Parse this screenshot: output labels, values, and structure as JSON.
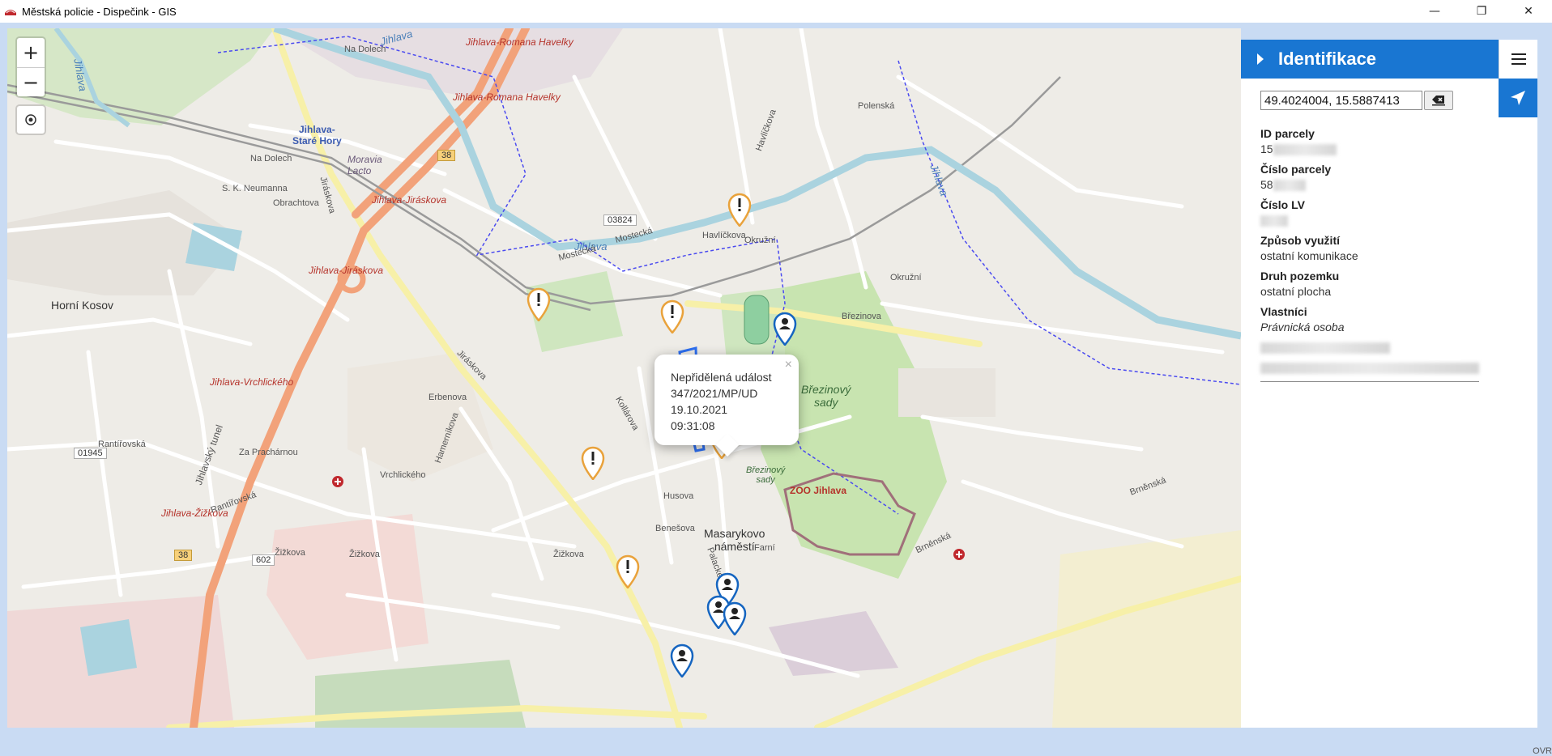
{
  "window": {
    "title": "Městská policie - Dispečink - GIS",
    "controls": {
      "minimize": "—",
      "restore": "❐",
      "close": "✕"
    }
  },
  "map": {
    "zoom_in": "+",
    "zoom_out": "−",
    "labels": {
      "romana_havelky_1": "Jihlava-Romana Havelky",
      "romana_havelky_2": "Jihlava-Romana Havelky",
      "stare_hory": "Jihlava-\nStaré Hory",
      "moravia_lacto": "Moravia\nLacto",
      "jiraskova_1": "Jihlava-Jiráskova",
      "jiraskova_2": "Jihlava-Jiráskova",
      "vrchlickeho": "Jihlava-Vrchlického",
      "zizkova": "Jihlava-Žižkova",
      "horni_kosov": "Horní Kosov",
      "brezinovy_sady": "Březinový\nsady",
      "brezinovy_sady_2": "Březinový\nsady",
      "zoo": "ZOO Jihlava",
      "masarykovo": "Masarykovo\nnáměstí",
      "jihlava_river_1": "Jihlava",
      "jihlava_river_2": "Jihlava",
      "jihlava_river_3": "Jihlava",
      "jihlava_river_4": "Jihlava",
      "street_neumanna": "S. K. Neumanna",
      "street_jiraskova": "Jiráskova",
      "street_jiraskova_2": "Jiráskova",
      "street_vrchlickeho": "Vrchlického",
      "street_zizkova_1": "Žižkova",
      "street_zizkova_2": "Žižkova",
      "street_zizkova_3": "Žižkova",
      "street_okruzni": "Okružní",
      "street_okruzni_2": "Okružní",
      "street_havlickova": "Havlíčkova",
      "street_havlickova_2": "Havlíčkova",
      "street_brezinova": "Březinova",
      "street_brnenska": "Brněnská",
      "street_brnenska_2": "Brněnská",
      "street_polenska": "Polenská",
      "street_mostecka": "Mostecká",
      "street_mostecka_2": "Mostecká",
      "street_na_dolech": "Na Dolech",
      "street_na_dolech_2": "Na Dolech",
      "street_obrachtova": "Obrachtova",
      "street_hamernikova": "Hamerníkova",
      "street_erbenova": "Erbenova",
      "street_rantirovska": "Rantířovská",
      "street_rantirovska_2": "Rantířovská",
      "street_za_prachárnou": "Za Prachárnou",
      "street_husova": "Husova",
      "street_benesova": "Benešova",
      "street_palackeho": "Palackého",
      "street_farni": "Farní",
      "street_jihlavsky_tunel": "Jihlavský tunel",
      "street_kollarova": "Kollárova"
    },
    "shields": {
      "r38_a": "38",
      "r38_b": "38",
      "r03824": "03824",
      "r01945": "01945",
      "r602": "602"
    },
    "popup": {
      "close": "×",
      "line1": "Nepřidělená událost",
      "line2": "347/2021/MP/UD",
      "line3": "19.10.2021",
      "line4": "09:31:08"
    }
  },
  "panel": {
    "title": "Identifikace",
    "coordinates": "49.4024004, 15.5887413",
    "fields": [
      {
        "label": "ID parcely",
        "value": "15"
      },
      {
        "label": "Číslo parcely",
        "value": "58"
      },
      {
        "label": "Číslo LV",
        "value": ""
      },
      {
        "label": "Způsob využití",
        "value": "ostatní komunikace"
      },
      {
        "label": "Druh pozemku",
        "value": "ostatní plocha"
      },
      {
        "label": "Vlastníci",
        "value": "Právnická osoba"
      }
    ]
  },
  "status": {
    "text": "OVR"
  },
  "colors": {
    "accent": "#1976d2",
    "event_marker": "#e9a23b",
    "unit_marker": "#1565c0"
  }
}
